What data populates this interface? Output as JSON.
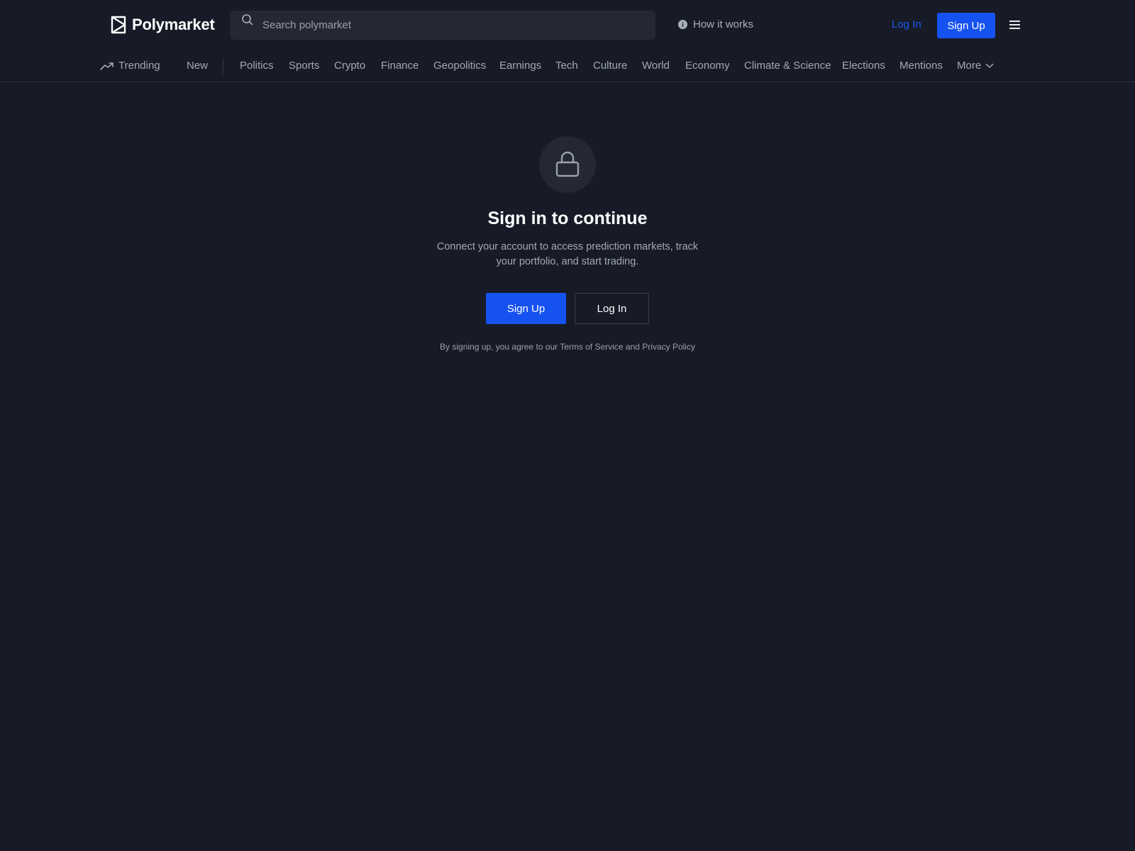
{
  "header": {
    "logo_text": "Polymarket",
    "search_placeholder": "Search polymarket",
    "how_it_works": "How it works",
    "login_label": "Log In",
    "signup_label": "Sign Up"
  },
  "nav": {
    "trending": "Trending",
    "new": "New",
    "categories": [
      "Politics",
      "Sports",
      "Crypto",
      "Finance",
      "Geopolitics",
      "Earnings",
      "Tech",
      "Culture",
      "World",
      "Economy",
      "Climate & Science",
      "Elections",
      "Mentions"
    ],
    "more": "More"
  },
  "auth": {
    "title": "Sign in to continue",
    "subtitle": "Connect your account to access prediction markets, track your portfolio, and start trading.",
    "signup_label": "Sign Up",
    "login_label": "Log In",
    "terms": "By signing up, you agree to our Terms of Service and Privacy Policy"
  },
  "colors": {
    "background": "#171b27",
    "accent": "#1652f0",
    "muted_text": "#a3a9b4"
  }
}
